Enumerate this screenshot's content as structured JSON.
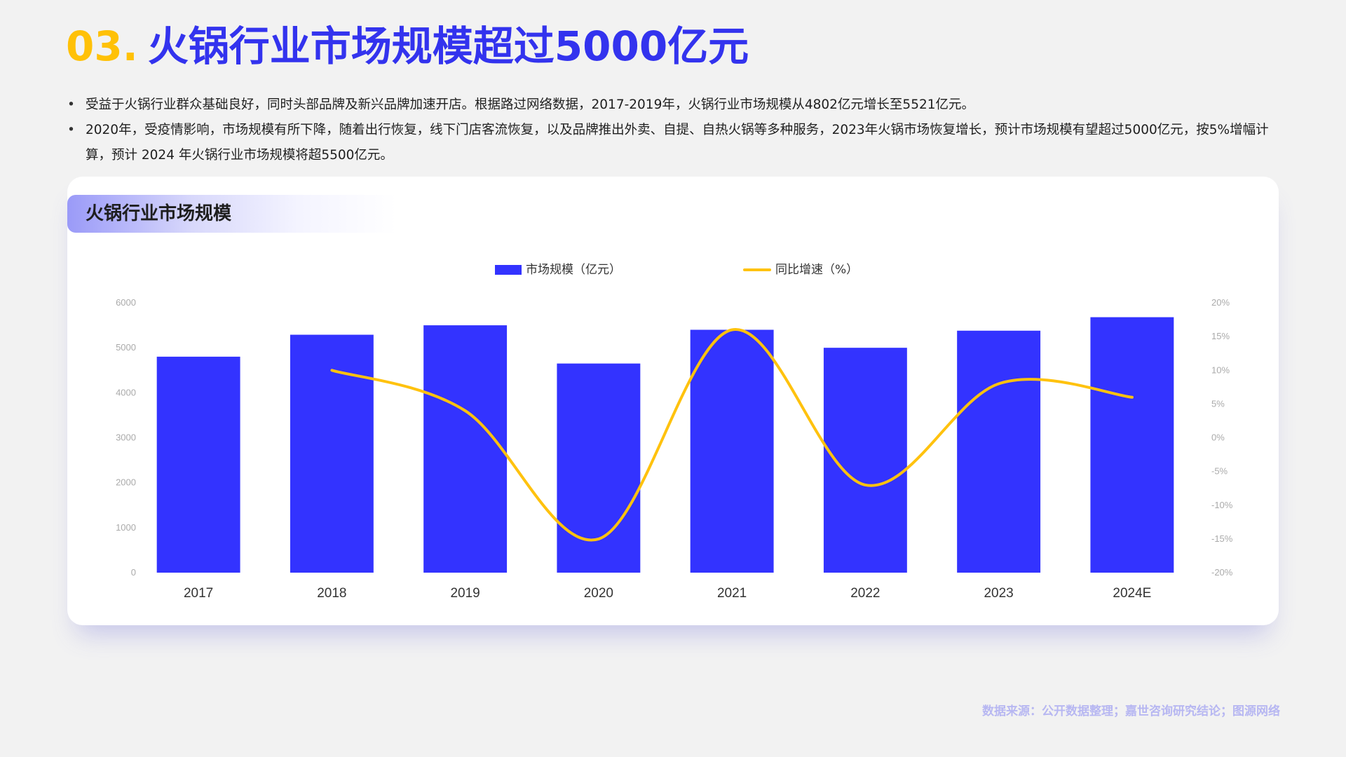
{
  "header": {
    "number": "03.",
    "title": "火锅行业市场规模超过5000亿元"
  },
  "bullets": [
    "受益于火锅行业群众基础良好，同时头部品牌及新兴品牌加速开店。根据路过网络数据，2017-2019年，火锅行业市场规模从4802亿元增长至5521亿元。",
    "2020年，受疫情影响，市场规模有所下降，随着出行恢复，线下门店客流恢复，以及品牌推出外卖、自提、自热火锅等多种服务，2023年火锅市场恢复增长，预计市场规模有望超过5000亿元，按5%增幅计算，预计 2024 年火锅行业市场规模将超5500亿元。"
  ],
  "card": {
    "title": "火锅行业市场规模"
  },
  "source": "数据来源：公开数据整理；嘉世咨询研究结论；图源网络",
  "colors": {
    "title_number": "#FFC107",
    "title_main": "#3333EE",
    "bar": "#3333FF",
    "line": "#FFC20E",
    "axis_text": "#aaaaaa",
    "source_text": "#b7b7f2"
  },
  "chart_data": {
    "type": "bar",
    "categories": [
      "2017",
      "2018",
      "2019",
      "2020",
      "2021",
      "2022",
      "2023",
      "2024E"
    ],
    "series": [
      {
        "name": "市场规模（亿元）",
        "type": "bar",
        "axis": "left",
        "values": [
          4802,
          5290,
          5500,
          4650,
          5400,
          5000,
          5380,
          5680
        ]
      },
      {
        "name": "同比增速（%）",
        "type": "line",
        "axis": "right",
        "smooth": true,
        "values": [
          null,
          10,
          4,
          -15,
          16,
          -7,
          8,
          6
        ]
      }
    ],
    "y_left": {
      "range": [
        0,
        6000
      ],
      "ticks": [
        "0",
        "1000",
        "2000",
        "3000",
        "4000",
        "5000",
        "6000"
      ]
    },
    "y_right": {
      "range": [
        -20,
        20
      ],
      "ticks": [
        "-20%",
        "-15%",
        "-10%",
        "-5%",
        "0%",
        "5%",
        "10%",
        "15%",
        "20%"
      ]
    },
    "legend_position": "top-center",
    "grid": false
  }
}
